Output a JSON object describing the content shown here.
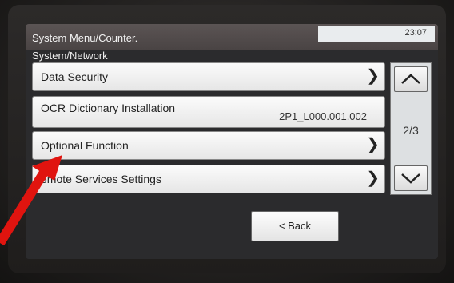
{
  "header": {
    "breadcrumb": "System Menu/Counter.",
    "time": "23:07",
    "section": "System/Network"
  },
  "items": [
    {
      "label": "Data Security"
    },
    {
      "label": "OCR Dictionary Installation",
      "value": "2P1_L000.001.002"
    },
    {
      "label": "Optional Function"
    },
    {
      "label": "emote Services Settings"
    }
  ],
  "pager": {
    "page": "2/3"
  },
  "footer": {
    "back_label": "< Back"
  },
  "colors": {
    "annotation_arrow": "#e0140f",
    "titlebar": "#5b5454"
  },
  "icons": [
    "chevron-right-icon",
    "chevron-up-icon",
    "chevron-down-icon"
  ]
}
